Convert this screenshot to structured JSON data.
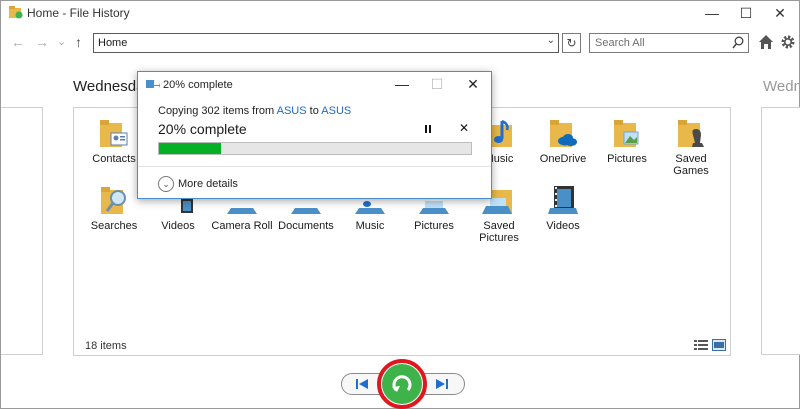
{
  "window": {
    "title": "Home - File History",
    "minimize": "—",
    "maximize": "☐",
    "close": "✕"
  },
  "nav": {
    "back": "←",
    "forward": "→",
    "recent": "⌄",
    "up": "↑",
    "address": "Home",
    "address_dropdown": "⌄",
    "refresh": "↻",
    "search_placeholder": "Search All"
  },
  "panels": {
    "current_date": "Wednesday",
    "next_date": "Wedn"
  },
  "main": {
    "row1": [
      {
        "label": "Contacts",
        "icon": "contacts-folder-icon"
      },
      {
        "label": "Music",
        "icon": "music-folder-icon"
      },
      {
        "label": "OneDrive",
        "icon": "onedrive-folder-icon"
      },
      {
        "label": "Pictures",
        "icon": "pictures-folder-icon"
      },
      {
        "label": "Saved Games",
        "icon": "saved-games-folder-icon"
      }
    ],
    "row2": [
      {
        "label": "Searches",
        "icon": "searches-folder-icon"
      },
      {
        "label": "Videos",
        "icon": "videos-folder-icon"
      },
      {
        "label": "Camera Roll",
        "icon": "camera-roll-folder-icon"
      },
      {
        "label": "Documents",
        "icon": "documents-folder-icon"
      },
      {
        "label": "Music",
        "icon": "music-library-icon"
      },
      {
        "label": "Pictures",
        "icon": "pictures-library-icon"
      },
      {
        "label": "Saved Pictures",
        "icon": "saved-pictures-icon"
      },
      {
        "label": "Videos",
        "icon": "videos-library-icon"
      }
    ],
    "items_count": "18 items"
  },
  "dialog": {
    "title": "20% complete",
    "copy_prefix": "Copying 302 items from ",
    "source": "ASUS",
    "copy_mid": " to ",
    "destination": "ASUS",
    "percent_label": "20% complete",
    "progress": 0.2,
    "cancel": "✕",
    "minimize": "—",
    "maximize": "☐",
    "close": "✕",
    "more_details": "More details",
    "more_icon": "⌄"
  },
  "colors": {
    "progress_fill": "#06b025",
    "restore_button": "#3db34a",
    "highlight_ring": "#e0171f",
    "link": "#1b6ac9"
  }
}
